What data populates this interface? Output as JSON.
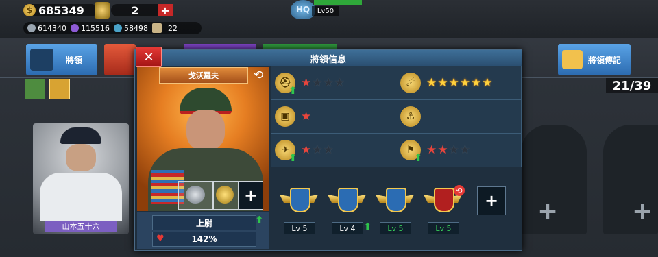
{
  "header": {
    "coins": "685349",
    "medals": "2",
    "hq_label": "HQ",
    "hq_level": "Lv50",
    "res1": "614340",
    "res2": "115516",
    "res3": "58498",
    "res4": "22"
  },
  "tabs": {
    "generals": "將領",
    "biography": "將領傳記"
  },
  "roster_count": "21/39",
  "left_general_name": "山本五十六",
  "panel": {
    "title": "將領信息",
    "close": "✕",
    "general_name": "戈沃羅夫",
    "rank": "上尉",
    "hp_pct": "142%",
    "slot_plus": "+",
    "empty_plus": "+"
  },
  "skills": [
    {
      "name": "infantry-icon",
      "level": 1,
      "max": 4,
      "upgradable": true
    },
    {
      "name": "artillery-icon",
      "level": 6,
      "max": 6,
      "gold": true,
      "upgradable": false
    },
    {
      "name": "tank-icon",
      "level": 1,
      "max": 1,
      "upgradable": false
    },
    {
      "name": "navy-icon",
      "level": 0,
      "max": 0,
      "upgradable": false
    },
    {
      "name": "airforce-icon",
      "level": 1,
      "max": 3,
      "upgradable": true
    },
    {
      "name": "engineer-icon",
      "level": 2,
      "max": 4,
      "upgradable": true
    }
  ],
  "badges": [
    {
      "name": "badge-1",
      "level": "Lv 5",
      "lv_color": "#ffffff",
      "upgradable": false
    },
    {
      "name": "badge-2",
      "level": "Lv 4",
      "lv_color": "#ffffff",
      "upgradable": true
    },
    {
      "name": "badge-3",
      "level": "Lv 5",
      "lv_color": "#37d05a",
      "upgradable": false
    },
    {
      "name": "badge-4",
      "level": "Lv 5",
      "lv_color": "#37d05a",
      "upgradable": false
    }
  ],
  "colors": {
    "accent_red": "#c62828",
    "gold": "#ffd23d",
    "star_red": "#e8453c"
  }
}
